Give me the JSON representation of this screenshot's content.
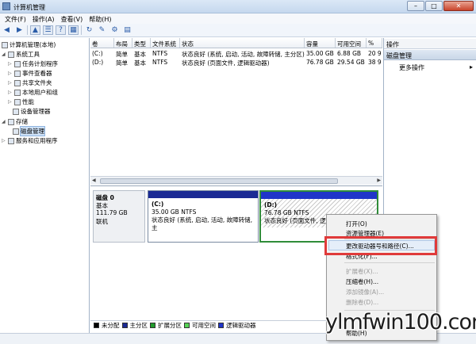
{
  "window": {
    "title": "计算机管理"
  },
  "menu": [
    "文件(F)",
    "操作(A)",
    "查看(V)",
    "帮助(H)"
  ],
  "toolbar": [
    "back-icon",
    "forward-icon",
    "up-icon",
    "list-icon",
    "help-icon",
    "properties-icon",
    "refresh-icon",
    "export-icon",
    "settings-icon",
    "disk-icon"
  ],
  "tree": [
    {
      "label": "计算机管理(本地)",
      "icon": "computer-icon"
    },
    {
      "label": "系统工具",
      "icon": "tools-icon"
    },
    {
      "label": "任务计划程序",
      "icon": "clock-icon"
    },
    {
      "label": "事件查看器",
      "icon": "event-icon"
    },
    {
      "label": "共享文件夹",
      "icon": "folder-icon"
    },
    {
      "label": "本地用户和组",
      "icon": "users-icon"
    },
    {
      "label": "性能",
      "icon": "performance-icon"
    },
    {
      "label": "设备管理器",
      "icon": "device-icon"
    },
    {
      "label": "存储",
      "icon": "storage-icon"
    },
    {
      "label": "磁盘管理",
      "icon": "disk-icon"
    },
    {
      "label": "服务和应用程序",
      "icon": "services-icon"
    }
  ],
  "columns": [
    "卷",
    "布局",
    "类型",
    "文件系统",
    "状态",
    "容量",
    "可用空间",
    "%"
  ],
  "volumes": [
    {
      "vol": "(C:)",
      "layout": "简单",
      "type": "基本",
      "fs": "NTFS",
      "status": "状态良好 (系统, 启动, 活动, 故障转储, 主分区)",
      "capacity": "35.00 GB",
      "free": "6.88 GB",
      "pct": "20 9"
    },
    {
      "vol": "(D:)",
      "layout": "简单",
      "type": "基本",
      "fs": "NTFS",
      "status": "状态良好 (页面文件, 逻辑驱动器)",
      "capacity": "76.78 GB",
      "free": "29.54 GB",
      "pct": "38 9"
    }
  ],
  "disk": {
    "name": "磁盘 0",
    "type": "基本",
    "size": "111.79 GB",
    "state": "联机"
  },
  "partitions": [
    {
      "name": "(C:)",
      "size": "35.00 GB NTFS",
      "status": "状态良好 (系统, 启动, 活动, 故障转储, 主"
    },
    {
      "name": "(D:)",
      "size": "76.78 GB NTFS",
      "status": "状态良好 (页面文件, 逻辑"
    }
  ],
  "legend": [
    {
      "label": "未分配",
      "color": "#000000"
    },
    {
      "label": "主分区",
      "color": "#1b2a94"
    },
    {
      "label": "扩展分区",
      "color": "#1f9a2a"
    },
    {
      "label": "可用空间",
      "color": "#55d255"
    },
    {
      "label": "逻辑驱动器",
      "color": "#2035c9"
    }
  ],
  "actions": {
    "header": "操作",
    "section": "磁盘管理",
    "more": "更多操作"
  },
  "context_menu": {
    "items": [
      {
        "label": "打开(O)",
        "disabled": false
      },
      {
        "label": "资源管理器(E)",
        "disabled": false
      },
      {
        "label": "更改驱动器号和路径(C)...",
        "disabled": false
      },
      {
        "label": "格式化(F)...",
        "disabled": false
      },
      {
        "label": "扩展卷(X)...",
        "disabled": true
      },
      {
        "label": "压缩卷(H)...",
        "disabled": false
      },
      {
        "label": "添加镜像(A)...",
        "disabled": true
      },
      {
        "label": "删除卷(D)...",
        "disabled": true
      },
      {
        "label": "帮助(H)",
        "disabled": false
      }
    ]
  },
  "watermark": "ylmfwin100.com"
}
